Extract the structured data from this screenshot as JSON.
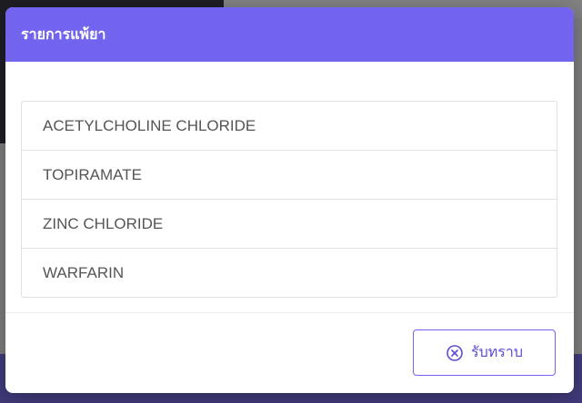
{
  "modal": {
    "title": "รายการแพ้ยา",
    "items": [
      "ACETYLCHOLINE CHLORIDE",
      "TOPIRAMATE",
      "ZINC CHLORIDE",
      "WARFARIN"
    ],
    "acknowledge_label": "รับทราบ",
    "acknowledge_icon": "close-circle-icon"
  },
  "colors": {
    "header": "#7264ee",
    "accent": "#5a4dd8"
  }
}
